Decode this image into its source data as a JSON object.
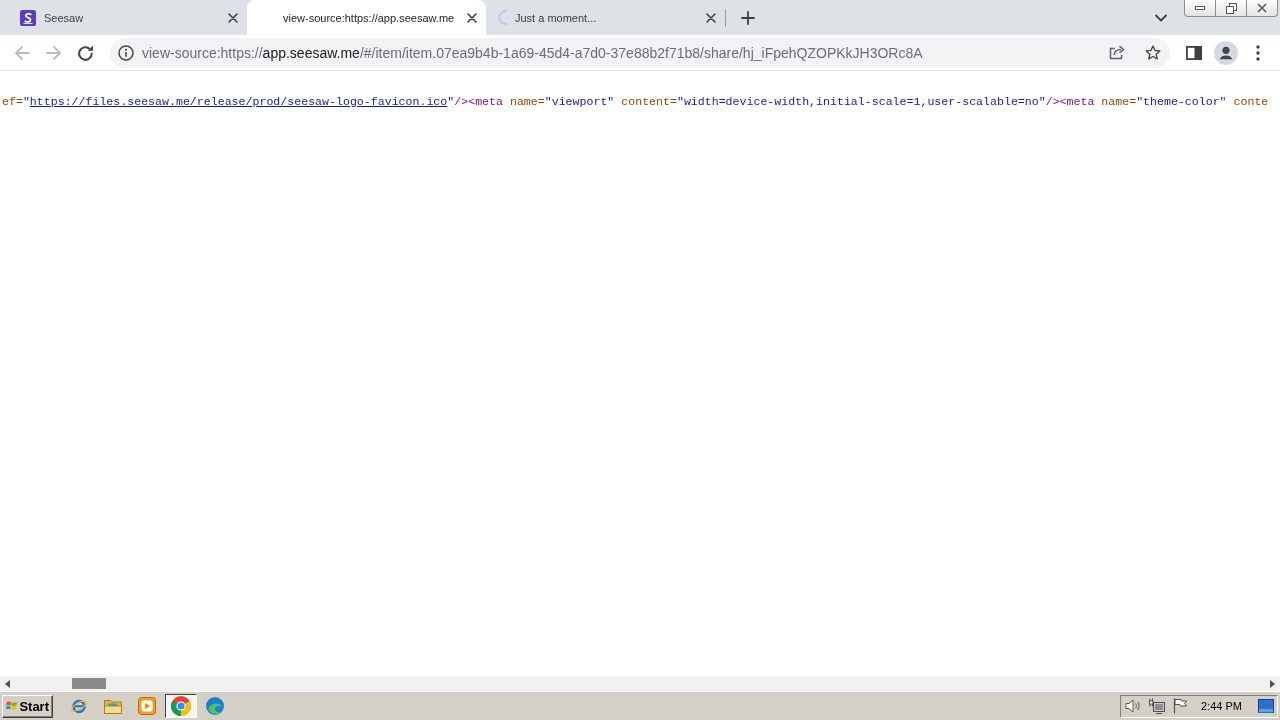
{
  "tabs": [
    {
      "kind": "site",
      "title": "Seesaw",
      "selected": false
    },
    {
      "kind": "view_source",
      "title": "view-source:https://app.seesaw.me",
      "selected": true
    },
    {
      "kind": "loading",
      "title": "Just a moment...",
      "selected": false
    }
  ],
  "toolbar": {
    "nav_buttons": [
      {
        "kind": "back",
        "disabled": true
      },
      {
        "kind": "forward",
        "disabled": true
      },
      {
        "kind": "reload",
        "disabled": false
      }
    ],
    "address_bar": {
      "prefix": "view-source:https://",
      "host": "app.seesaw.me",
      "path": "/#/item/item.07ea9b4b-1a69-45d4-a7d0-37e88b2f71b8/share/hj_iFpehQZOPKkJH3ORc8A"
    }
  },
  "source_line": [
    {
      "kind": "attr_name",
      "text": "ef="
    },
    {
      "kind": "attr_value",
      "text": "\""
    },
    {
      "kind": "link",
      "text": "https://files.seesaw.me/release/prod/seesaw-logo-favicon.ico"
    },
    {
      "kind": "attr_value",
      "text": "\""
    },
    {
      "kind": "tag",
      "text": "/><meta"
    },
    {
      "kind": "attr_name",
      "text": " name="
    },
    {
      "kind": "attr_value",
      "text": "\"viewport\""
    },
    {
      "kind": "attr_name",
      "text": " content="
    },
    {
      "kind": "attr_value",
      "text": "\"width=device-width,initial-scale=1,user-scalable=no\""
    },
    {
      "kind": "tag",
      "text": "/><meta"
    },
    {
      "kind": "attr_name",
      "text": " name="
    },
    {
      "kind": "attr_value",
      "text": "\"theme-color\""
    },
    {
      "kind": "attr_name",
      "text": " conte"
    }
  ],
  "taskbar": {
    "start_button": "Start",
    "apps": [
      {
        "kind": "ie",
        "selected": false
      },
      {
        "kind": "folder",
        "selected": false
      },
      {
        "kind": "player",
        "selected": false
      },
      {
        "kind": "chrome",
        "selected": true
      },
      {
        "kind": "edge",
        "selected": false
      }
    ],
    "clock": "2:44 PM"
  }
}
